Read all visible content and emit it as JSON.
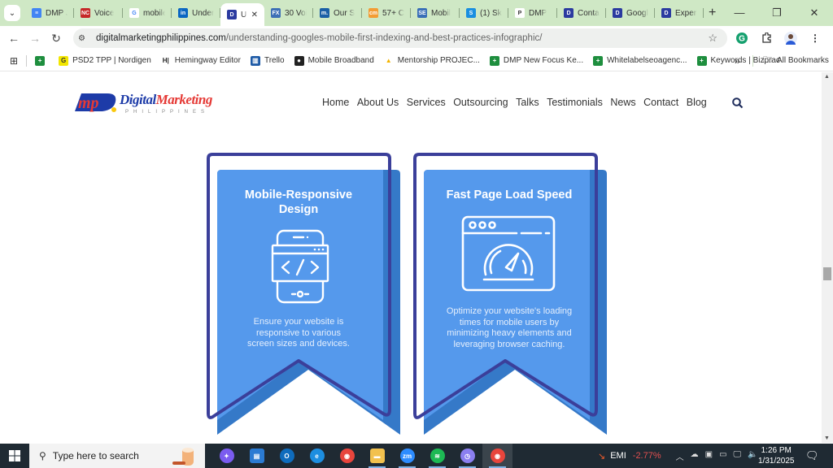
{
  "browser": {
    "tabs": [
      {
        "title": "DMP J",
        "favicon": "docs-icon",
        "color": "#4285f4",
        "glyph": "≡"
      },
      {
        "title": "Voice",
        "favicon": "nc-icon",
        "color": "#c62828",
        "glyph": "NC"
      },
      {
        "title": "mobile",
        "favicon": "google-icon",
        "color": "#ffffff",
        "glyph": "G"
      },
      {
        "title": "Under",
        "favicon": "linkedin-icon",
        "color": "#0a66c2",
        "glyph": "in"
      },
      {
        "title": "U",
        "favicon": "dmp-icon",
        "color": "#2b3aa0",
        "glyph": "D",
        "active": true
      },
      {
        "title": "30 Voi",
        "favicon": "fx-icon",
        "color": "#3d6fb6",
        "glyph": "FX"
      },
      {
        "title": "Our S",
        "favicon": "m-icon",
        "color": "#1a5fa6",
        "glyph": "m."
      },
      {
        "title": "57+ C",
        "favicon": "cm-icon",
        "color": "#f39c34",
        "glyph": "cm"
      },
      {
        "title": "Mobil",
        "favicon": "sel-icon",
        "color": "#3a6fb7",
        "glyph": "SE"
      },
      {
        "title": "(1) Sk",
        "favicon": "skype-icon",
        "color": "#1a8fe0",
        "glyph": "S"
      },
      {
        "title": "DMP",
        "favicon": "p-icon",
        "color": "#ffffff",
        "glyph": "P"
      },
      {
        "title": "Conta",
        "favicon": "dmp-icon",
        "color": "#2b3aa0",
        "glyph": "D"
      },
      {
        "title": "Googl",
        "favicon": "dmp-icon",
        "color": "#2b3aa0",
        "glyph": "D"
      },
      {
        "title": "Experi",
        "favicon": "dmp-icon",
        "color": "#2b3aa0",
        "glyph": "D"
      }
    ],
    "url_domain": "digitalmarketingphilippines.com",
    "url_path": "/understanding-googles-mobile-first-indexing-and-best-practices-infographic/",
    "bookmarks": [
      {
        "label": "",
        "icon": "sheets-icon"
      },
      {
        "label": "PSD2 TPP | Nordigen",
        "icon": "nordigen-icon"
      },
      {
        "label": "Hemingway Editor",
        "icon": "hemingway-icon"
      },
      {
        "label": "Trello",
        "icon": "trello-icon"
      },
      {
        "label": "Mobile Broadband",
        "icon": "globe-icon"
      },
      {
        "label": "Mentorship PROJEC...",
        "icon": "drive-icon"
      },
      {
        "label": "DMP New Focus Ke...",
        "icon": "sheets-icon"
      },
      {
        "label": "Whitelabelseoagenc...",
        "icon": "sheets-icon"
      },
      {
        "label": "Keywords | Bizprac",
        "icon": "sheets-icon"
      }
    ],
    "more_bookmarks": "»",
    "all_bookmarks": "All Bookmarks"
  },
  "site": {
    "logo_main_1": "Digital",
    "logo_main_2": "Marketing",
    "logo_sub": "PHILIPPINES",
    "nav": [
      "Home",
      "About Us",
      "Services",
      "Outsourcing",
      "Talks",
      "Testimonials",
      "News",
      "Contact",
      "Blog"
    ],
    "colors": {
      "card_blue": "#5599ec",
      "card_shadow": "#3579c8",
      "outline": "#3b3f9a"
    },
    "cards": [
      {
        "title_1": "Mobile-Responsive",
        "title_2": "Design",
        "icon": "mobile-code-icon",
        "desc": [
          "Ensure your website is",
          "responsive to various",
          "screen sizes and devices."
        ]
      },
      {
        "title_1": "Fast Page Load Speed",
        "title_2": "",
        "icon": "speedometer-browser-icon",
        "desc": [
          "Optimize your website's loading",
          "times for mobile users by",
          "minimizing heavy elements and",
          "leveraging browser caching."
        ]
      }
    ]
  },
  "taskbar": {
    "search_placeholder": "Type here to search",
    "apps": [
      "copilot",
      "store",
      "outlook",
      "edge",
      "chrome",
      "file-explorer",
      "zoom",
      "spotify",
      "clockify",
      "chrome-profile"
    ],
    "stock_name": "EMI",
    "stock_change": "-2.77%",
    "time": "1:26 PM",
    "date": "1/31/2025"
  }
}
